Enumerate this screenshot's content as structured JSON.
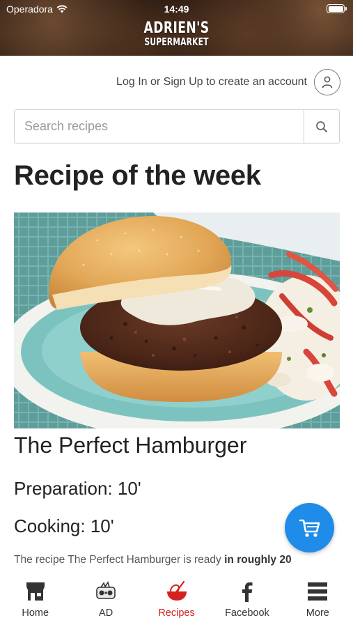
{
  "status_bar": {
    "carrier": "Operadora",
    "time": "14:49"
  },
  "header": {
    "logo_line1": "ADRIEN'S",
    "logo_line2": "SUPERMARKET"
  },
  "account": {
    "login_text": "Log In or Sign Up to create an account"
  },
  "search": {
    "placeholder": "Search recipes",
    "value": ""
  },
  "section_title": "Recipe of the week",
  "recipe": {
    "name": "The Perfect Hamburger",
    "preparation": "Preparation: 10'",
    "cooking": "Cooking: 10'",
    "description_prefix": "The recipe The Perfect Hamburger is ready ",
    "description_bold": "in roughly 20"
  },
  "tabs": [
    {
      "label": "Home",
      "icon": "store-icon"
    },
    {
      "label": "AD",
      "icon": "ad-icon"
    },
    {
      "label": "Recipes",
      "icon": "whisk-bowl-icon"
    },
    {
      "label": "Facebook",
      "icon": "facebook-icon"
    },
    {
      "label": "More",
      "icon": "menu-icon"
    }
  ],
  "active_tab": "Recipes",
  "colors": {
    "accent": "#1e8ce8",
    "active_tab": "#d72020"
  }
}
